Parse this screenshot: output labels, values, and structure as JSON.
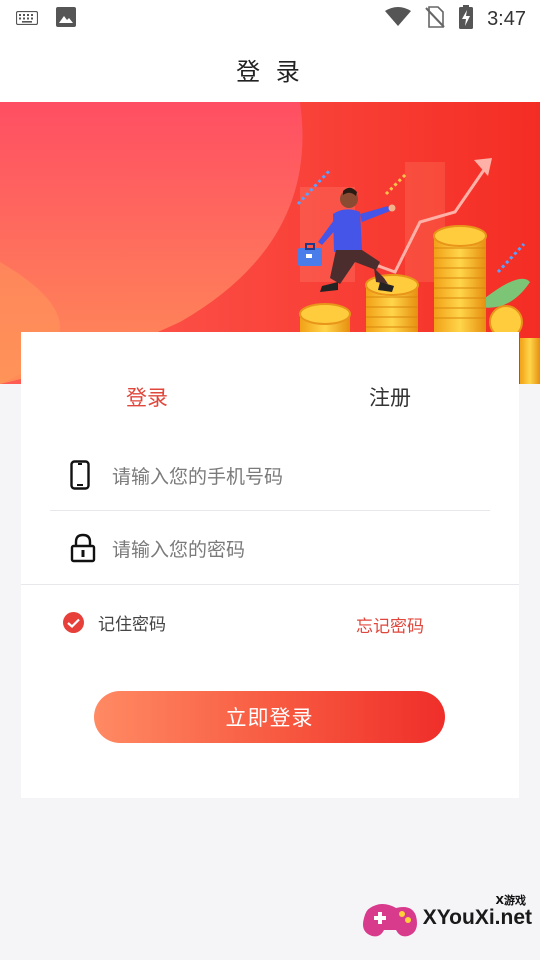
{
  "status_bar": {
    "time": "3:47",
    "icons": [
      "keyboard-icon",
      "image-icon",
      "wifi-icon",
      "no-sim-icon",
      "battery-charging-icon"
    ]
  },
  "header": {
    "title": "登 录"
  },
  "tabs": {
    "login": "登录",
    "register": "注册"
  },
  "form": {
    "phone_placeholder": "请输入您的手机号码",
    "password_placeholder": "请输入您的密码",
    "remember_label": "记住密码",
    "forgot_label": "忘记密码",
    "submit_label": "立即登录"
  },
  "colors": {
    "accent": "#e0473c",
    "button_start": "#ff8a63",
    "button_end": "#ef2e2a"
  },
  "watermark": {
    "small": "X游戏",
    "main": "XYouXi.net"
  }
}
